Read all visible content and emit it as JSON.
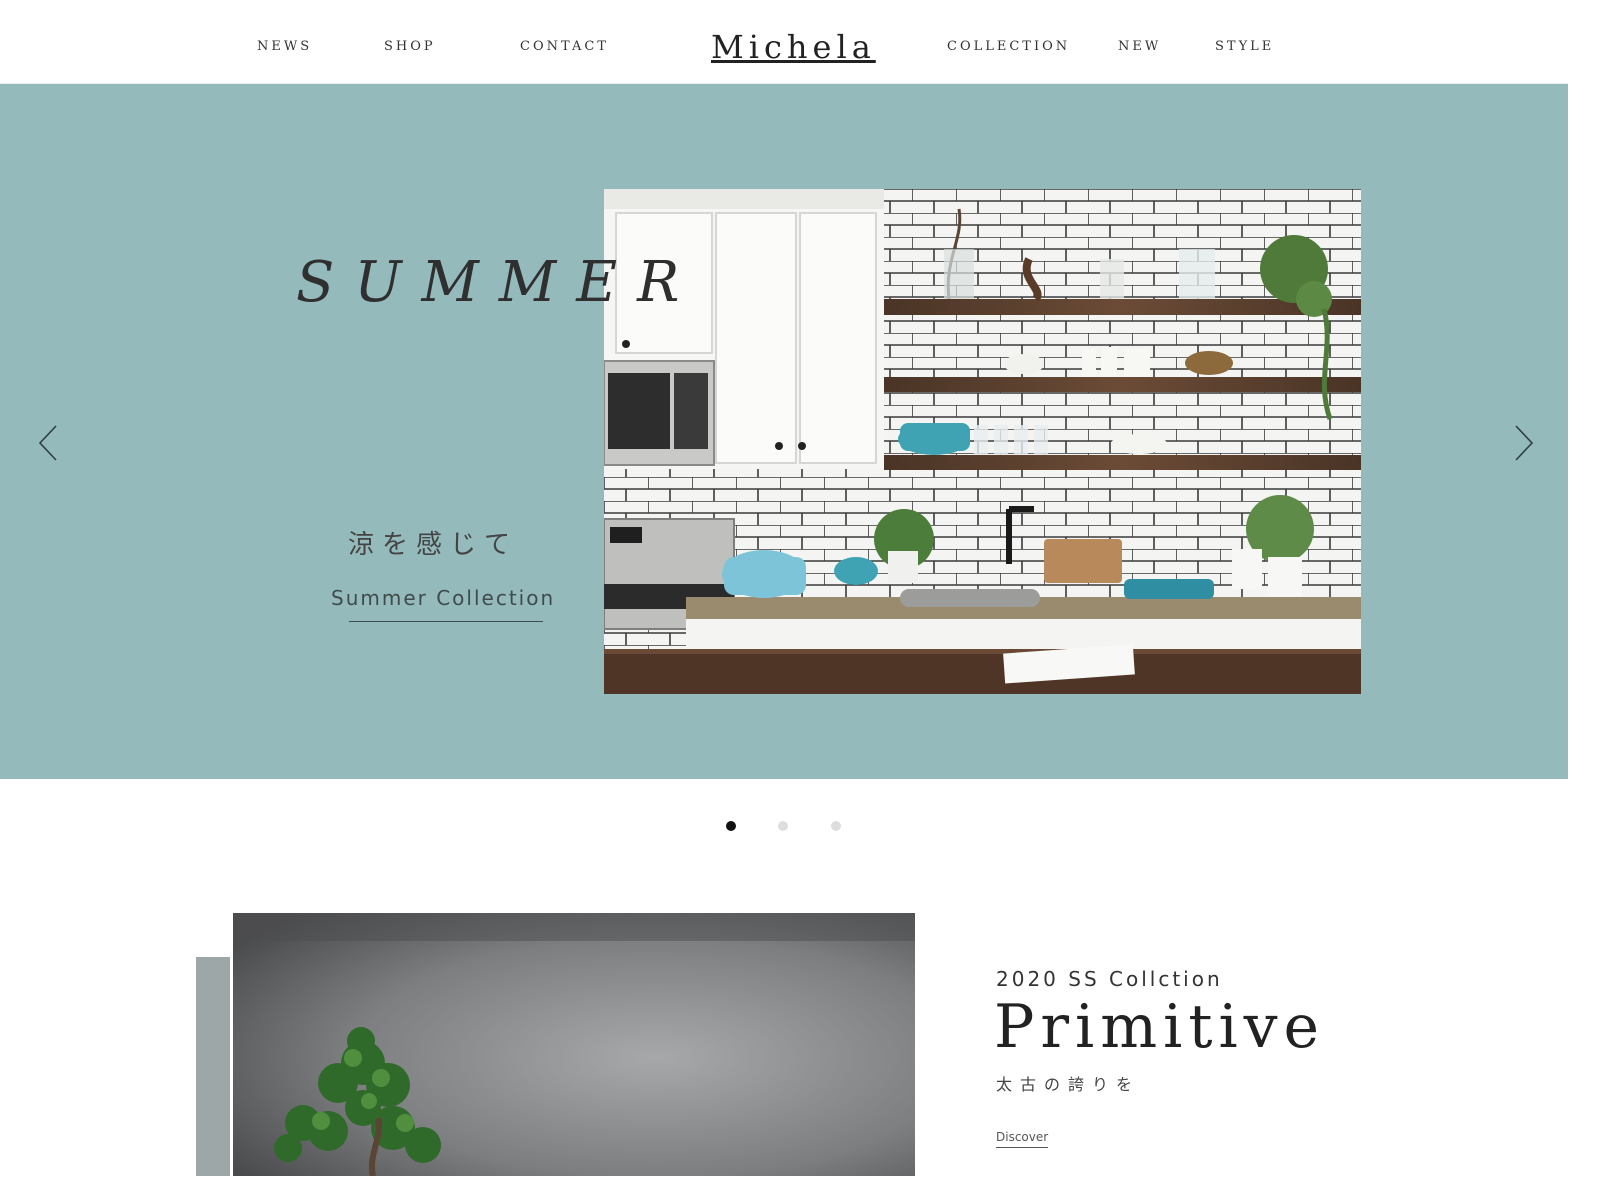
{
  "header": {
    "logo": "Michela",
    "nav_left": [
      "NEWS",
      "SHOP",
      "CONTACT"
    ],
    "nav_right": [
      "COLLECTION",
      "NEW",
      "STYLE"
    ]
  },
  "hero": {
    "title": "SUMMER",
    "subtitle_jp": "涼を感じて",
    "link_label": "Summer Collection",
    "background_color": "#94babc",
    "photo": "kitchen-shelves-photo",
    "prev_icon": "chevron-left-icon",
    "next_icon": "chevron-right-icon"
  },
  "carousel": {
    "slide_count": 3,
    "active_index": 0
  },
  "collection": {
    "season": "2020 SS Collction",
    "title": "Primitive",
    "subtitle_jp": "太古の誇りを",
    "link_label": "Discover",
    "photo": "bonsai-tree-photo",
    "accent_color": "#9ea7a8"
  }
}
